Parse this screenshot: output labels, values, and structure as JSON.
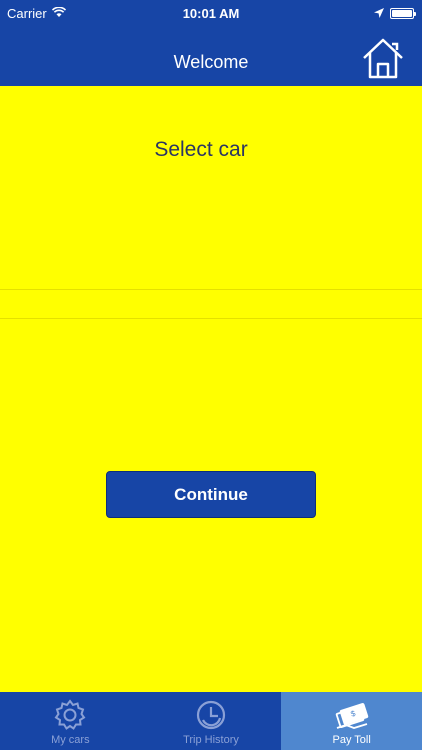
{
  "status_bar": {
    "carrier": "Carrier",
    "time": "10:01 AM"
  },
  "nav": {
    "title": "Welcome",
    "home_icon": "home-icon"
  },
  "content": {
    "select_label": "Select car",
    "continue_label": "Continue"
  },
  "tabs": [
    {
      "label": "My cars",
      "icon": "gear-icon",
      "active": false
    },
    {
      "label": "Trip History",
      "icon": "trip-history-icon",
      "active": false
    },
    {
      "label": "Pay Toll",
      "icon": "pay-toll-icon",
      "active": true
    }
  ],
  "colors": {
    "brand_blue": "#1745a6",
    "background_yellow": "#ffff00",
    "active_tab": "#4f87cf"
  }
}
